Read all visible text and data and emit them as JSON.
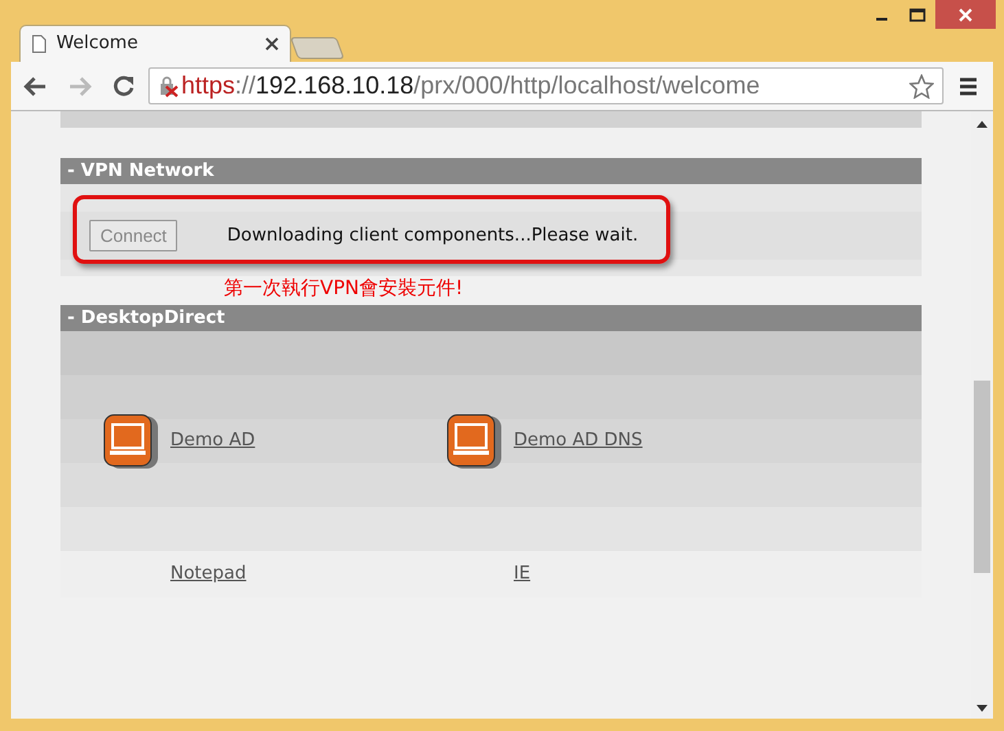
{
  "tab": {
    "title": "Welcome",
    "selected": true
  },
  "address_bar": {
    "scheme": "https",
    "separator": "://",
    "host": "192.168.10.18",
    "path": "/prx/000/http/localhost/welcome",
    "secure": false
  },
  "sections": [
    {
      "kind": "vpn",
      "title": "- VPN Network",
      "button": {
        "label": "Connect",
        "disabled": true
      },
      "message": "Downloading client components...Please wait.",
      "highlighted": true,
      "note": "第一次執行VPN會安裝元件!"
    },
    {
      "kind": "apps",
      "title": "- DesktopDirect",
      "apps": [
        {
          "name": "Demo AD",
          "icon": true
        },
        {
          "name": "Demo AD DNS",
          "icon": true
        },
        {
          "name": "Notepad",
          "icon": false
        },
        {
          "name": "IE",
          "icon": false
        }
      ]
    }
  ]
}
